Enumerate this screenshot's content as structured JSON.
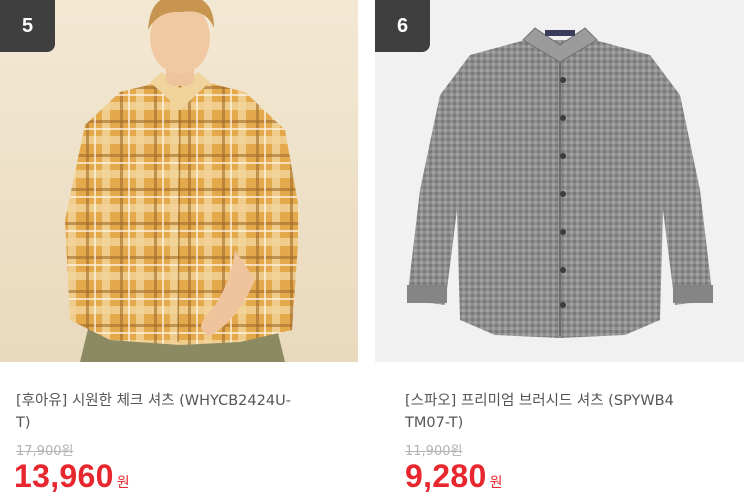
{
  "products": [
    {
      "rank": "5",
      "title": "[후아유] 시원한 체크 셔츠 (WHYCB2424U-\nT)",
      "original_price": "17,900원",
      "price": "13,960",
      "price_unit": "원"
    },
    {
      "rank": "6",
      "title": "[스파오] 프리미엄 브러시드 셔츠 (SPYWB4\nTM07-T)",
      "original_price": "11,900원",
      "price": "9,280",
      "price_unit": "원"
    }
  ]
}
